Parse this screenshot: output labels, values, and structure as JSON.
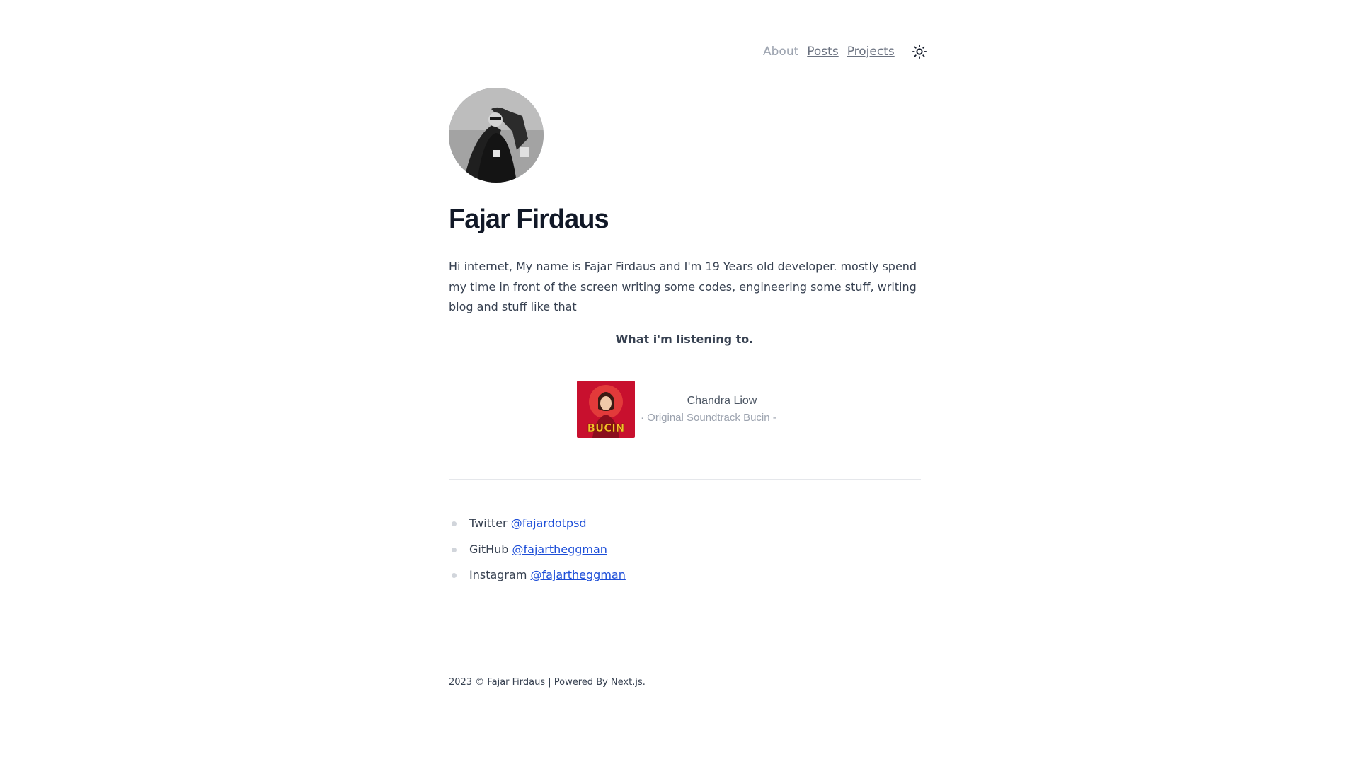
{
  "nav": {
    "about": "About",
    "posts": "Posts",
    "projects": "Projects",
    "theme_icon": "sun-icon"
  },
  "profile": {
    "name": "Fajar Firdaus",
    "bio": "Hi internet, My name is Fajar Firdaus and I'm 19 Years old developer. mostly spend my time in front of the screen writing some codes, engineering some stuff, writing blog and stuff like that"
  },
  "listening": {
    "heading": "What i'm listening to.",
    "artist": "Chandra Liow",
    "song": "· Original Soundtrack      Bucin -",
    "cover_text": "BUCIN"
  },
  "socials": [
    {
      "platform": "Twitter",
      "handle": "@fajardotpsd"
    },
    {
      "platform": "GitHub",
      "handle": "@fajartheggman"
    },
    {
      "platform": "Instagram",
      "handle": "@fajartheggman"
    }
  ],
  "footer": {
    "text": "2023 © Fajar Firdaus | Powered By Next.js."
  },
  "colors": {
    "link": "#1d4ed8",
    "heading": "#111827",
    "text": "#374151",
    "muted": "#9ca3af"
  }
}
